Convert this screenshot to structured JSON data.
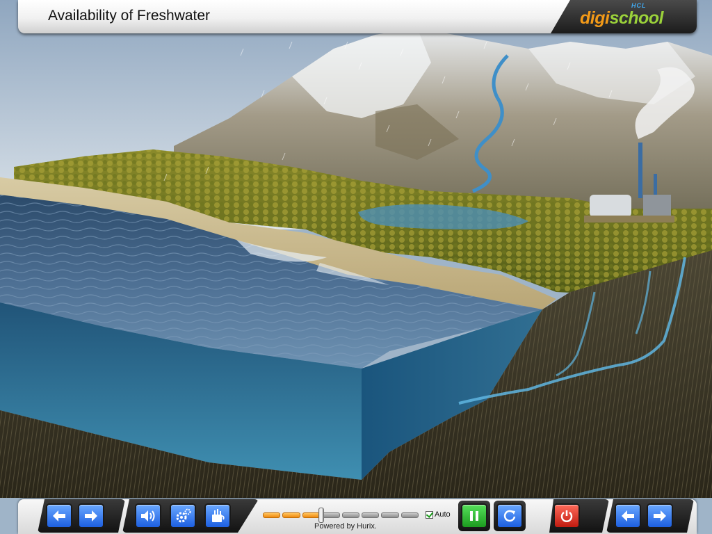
{
  "header": {
    "title": "Availability of Freshwater",
    "logo": {
      "top_text": "HCL",
      "word_part1": "digi",
      "word_part2": "school"
    }
  },
  "toolbar": {
    "powered_by": "Powered by Hurix.",
    "auto_label": "Auto",
    "auto_checked": true,
    "progress": {
      "segments_total": 8,
      "segments_complete": 3
    },
    "icons": {
      "left_prev": "arrow-left-icon",
      "left_next": "arrow-right-icon",
      "audio": "speaker-icon",
      "settings": "gear-icon",
      "tools": "toolbox-icon",
      "pause": "pause-icon",
      "replay": "replay-icon",
      "exit": "power-icon",
      "right_prev": "arrow-left-icon",
      "right_next": "arrow-right-icon"
    }
  },
  "colors": {
    "button_blue": "#2a6fe8",
    "button_green": "#27a82b",
    "button_red": "#d1261a",
    "progress_fill": "#f08a10",
    "logo_digi": "#f39a18",
    "logo_school": "#9bd23a",
    "logo_hcl": "#41a9f0"
  }
}
